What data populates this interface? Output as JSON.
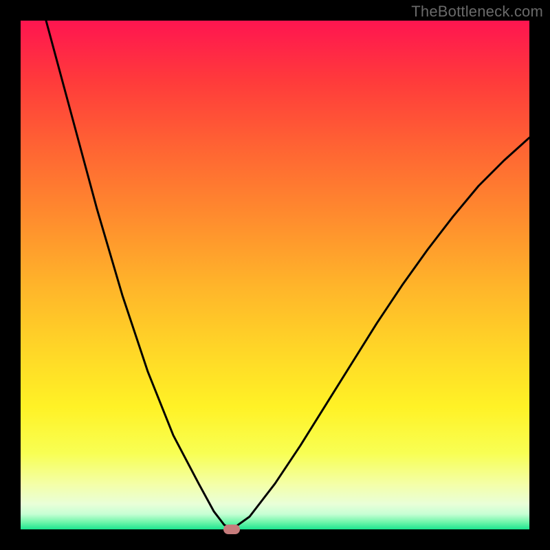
{
  "attribution": "TheBottleneck.com",
  "colors": {
    "marker_fill": "#c77c7c",
    "curve_stroke": "#000000",
    "frame": "#000000"
  },
  "chart_data": {
    "type": "line",
    "title": "",
    "xlabel": "",
    "ylabel": "",
    "xlim": [
      0,
      100
    ],
    "ylim": [
      0,
      100
    ],
    "grid": false,
    "legend": false,
    "annotations": [],
    "marker": {
      "x": 41.5,
      "y": 0,
      "shape": "rounded-rect"
    },
    "series": [
      {
        "name": "left-branch",
        "x": [
          5,
          10,
          15,
          20,
          25,
          30,
          35,
          38,
          40,
          41.5
        ],
        "values": [
          100,
          81.5,
          63,
          46,
          31,
          18.5,
          9,
          3.5,
          0.9,
          0
        ]
      },
      {
        "name": "right-branch",
        "x": [
          41.5,
          45,
          50,
          55,
          60,
          65,
          70,
          75,
          80,
          85,
          90,
          95,
          100
        ],
        "values": [
          0,
          2.5,
          9,
          16.5,
          24.5,
          32.5,
          40.5,
          48,
          55,
          61.5,
          67.5,
          72.5,
          77
        ]
      }
    ]
  }
}
